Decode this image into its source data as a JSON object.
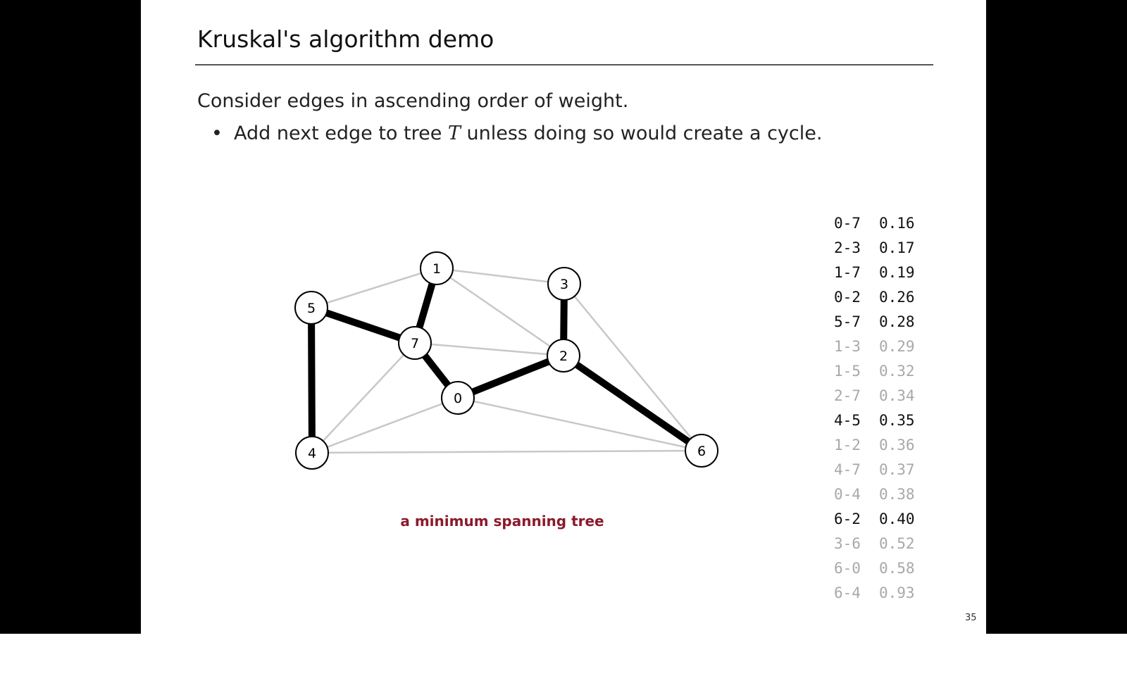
{
  "slide": {
    "title": "Kruskal's algorithm demo",
    "lead": "Consider edges in ascending order of weight.",
    "bullet": {
      "marker": "•",
      "pre": "Add next edge to tree ",
      "var": "T",
      "post": " unless doing so would create a cycle."
    },
    "caption": "a minimum spanning tree",
    "page_number": "35"
  },
  "graph": {
    "vertices": [
      "0",
      "1",
      "2",
      "3",
      "4",
      "5",
      "6",
      "7"
    ],
    "edges": [
      {
        "label": "0-7",
        "weight": "0.16",
        "in_mst": true
      },
      {
        "label": "2-3",
        "weight": "0.17",
        "in_mst": true
      },
      {
        "label": "1-7",
        "weight": "0.19",
        "in_mst": true
      },
      {
        "label": "0-2",
        "weight": "0.26",
        "in_mst": true
      },
      {
        "label": "5-7",
        "weight": "0.28",
        "in_mst": true
      },
      {
        "label": "1-3",
        "weight": "0.29",
        "in_mst": false
      },
      {
        "label": "1-5",
        "weight": "0.32",
        "in_mst": false
      },
      {
        "label": "2-7",
        "weight": "0.34",
        "in_mst": false
      },
      {
        "label": "4-5",
        "weight": "0.35",
        "in_mst": true
      },
      {
        "label": "1-2",
        "weight": "0.36",
        "in_mst": false
      },
      {
        "label": "4-7",
        "weight": "0.37",
        "in_mst": false
      },
      {
        "label": "0-4",
        "weight": "0.38",
        "in_mst": false
      },
      {
        "label": "6-2",
        "weight": "0.40",
        "in_mst": true
      },
      {
        "label": "3-6",
        "weight": "0.52",
        "in_mst": false
      },
      {
        "label": "6-0",
        "weight": "0.58",
        "in_mst": false
      },
      {
        "label": "6-4",
        "weight": "0.93",
        "in_mst": false
      }
    ]
  },
  "colors": {
    "mst_edge": "#000000",
    "other_edge": "#c8c8c8",
    "mst_text": "#111111",
    "other_text": "#a8a8a8",
    "caption": "#8b1a2b"
  }
}
